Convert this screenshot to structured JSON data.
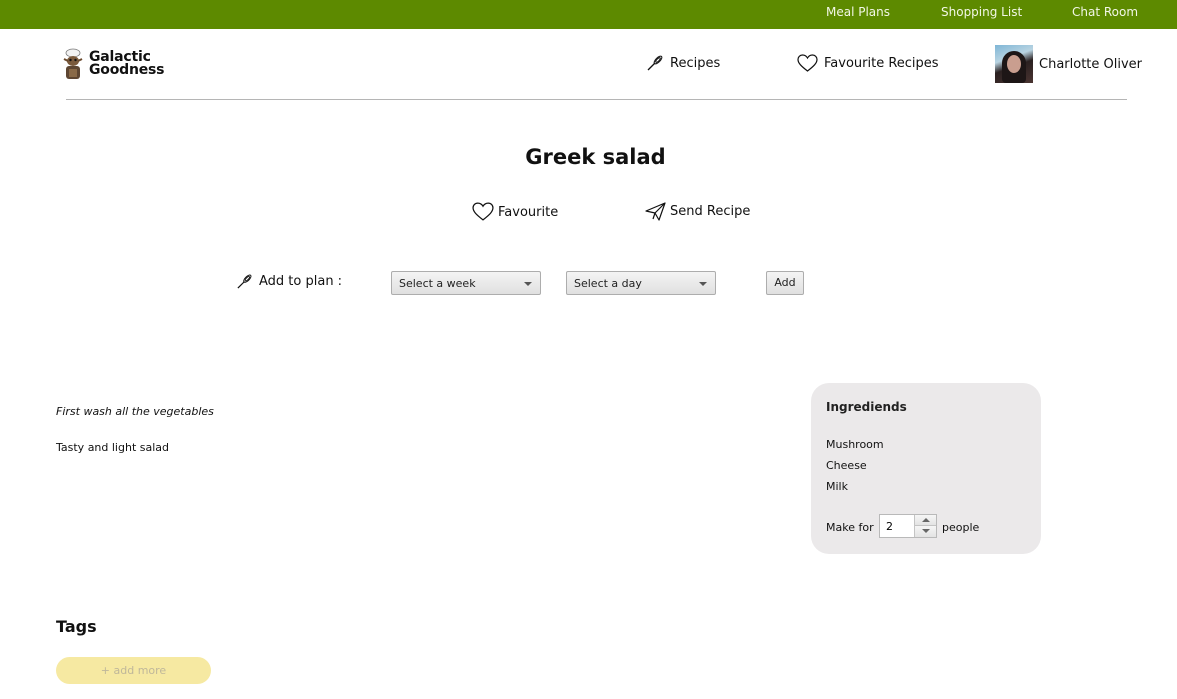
{
  "topbar": {
    "color": "#5d8a00",
    "links": [
      "Meal Plans",
      "Shopping List",
      "Chat Room"
    ]
  },
  "logo": {
    "line1": "Galactic",
    "line2": "Goodness"
  },
  "nav": {
    "recipes_label": "Recipes",
    "favourites_label": "Favourite Recipes",
    "user_name": "Charlotte Oliver"
  },
  "recipe": {
    "title": "Greek salad",
    "favourite_label": "Favourite",
    "send_label": "Send Recipe"
  },
  "plan": {
    "label": "Add to plan :",
    "week_select": "Select a week",
    "day_select": "Select a day",
    "add_button": "Add"
  },
  "steps": [
    "First wash all the vegetables",
    "Tasty and light salad"
  ],
  "ingredients": {
    "title": "Ingrediends",
    "items": [
      "Mushroom",
      "Cheese",
      "Milk"
    ],
    "make_for_label": "Make for",
    "servings": "2",
    "people_label": "people"
  },
  "tags": {
    "title": "Tags",
    "add_more": "+ add more"
  }
}
